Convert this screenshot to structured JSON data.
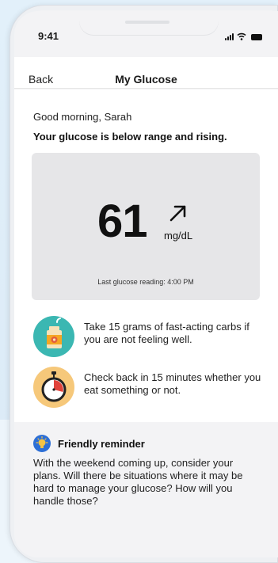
{
  "status_bar": {
    "time": "9:41"
  },
  "nav": {
    "back_label": "Back",
    "title": "My Glucose"
  },
  "greeting": "Good morning, Sarah",
  "status_message": "Your glucose is below range and rising.",
  "reading": {
    "value": "61",
    "unit": "mg/dL",
    "trend": "rising",
    "last_reading": "Last glucose reading: 4:00 PM"
  },
  "tips": [
    {
      "icon": "juice-icon",
      "text": "Take 15 grams of fast-acting carbs if you are not feeling well."
    },
    {
      "icon": "timer-icon",
      "text": "Check back in 15 minutes whether you eat something or not."
    }
  ],
  "reminder": {
    "icon": "lightbulb-icon",
    "title": "Friendly reminder",
    "body": "With the weekend coming up, consider your plans. Will there be situations where it may be hard to manage your glucose? How will you handle those?"
  },
  "colors": {
    "juice_bg": "#3bb7b2",
    "timer_bg": "#f6c87a",
    "bulb_bg": "#2d6fd6",
    "card_bg": "#e6e6e8"
  }
}
